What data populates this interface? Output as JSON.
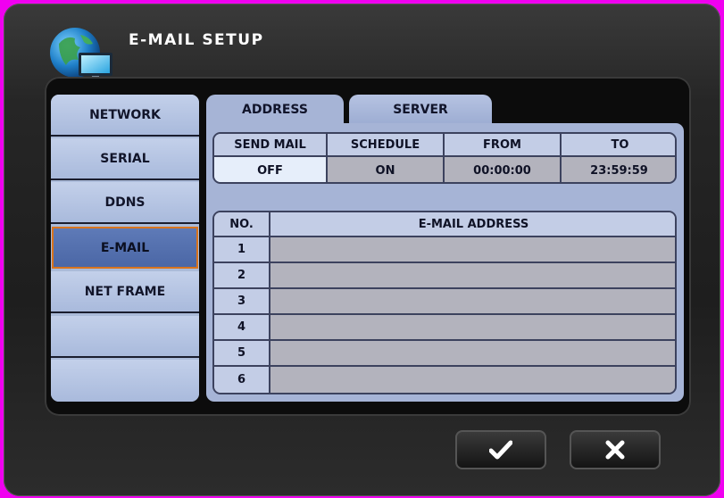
{
  "title": "E-MAIL SETUP",
  "sidebar": {
    "items": [
      {
        "label": "NETWORK"
      },
      {
        "label": "SERIAL"
      },
      {
        "label": "DDNS"
      },
      {
        "label": "E-MAIL",
        "active": true
      },
      {
        "label": "NET FRAME"
      },
      {
        "label": ""
      },
      {
        "label": ""
      }
    ]
  },
  "tabs": [
    {
      "label": "ADDRESS",
      "active": true
    },
    {
      "label": "SERVER"
    }
  ],
  "schedule": {
    "headers": [
      "SEND MAIL",
      "SCHEDULE",
      "FROM",
      "TO"
    ],
    "values": [
      "OFF",
      "ON",
      "00:00:00",
      "23:59:59"
    ]
  },
  "email_table": {
    "headers": [
      "NO.",
      "E-MAIL ADDRESS"
    ],
    "rows": [
      {
        "no": "1",
        "address": ""
      },
      {
        "no": "2",
        "address": ""
      },
      {
        "no": "3",
        "address": ""
      },
      {
        "no": "4",
        "address": ""
      },
      {
        "no": "5",
        "address": ""
      },
      {
        "no": "6",
        "address": ""
      }
    ]
  },
  "buttons": {
    "confirm_icon": "checkmark-icon",
    "cancel_icon": "x-icon"
  },
  "colors": {
    "panel": "#a6b4d6",
    "active_border": "#d9741d",
    "active_fill": "#5470ae"
  }
}
